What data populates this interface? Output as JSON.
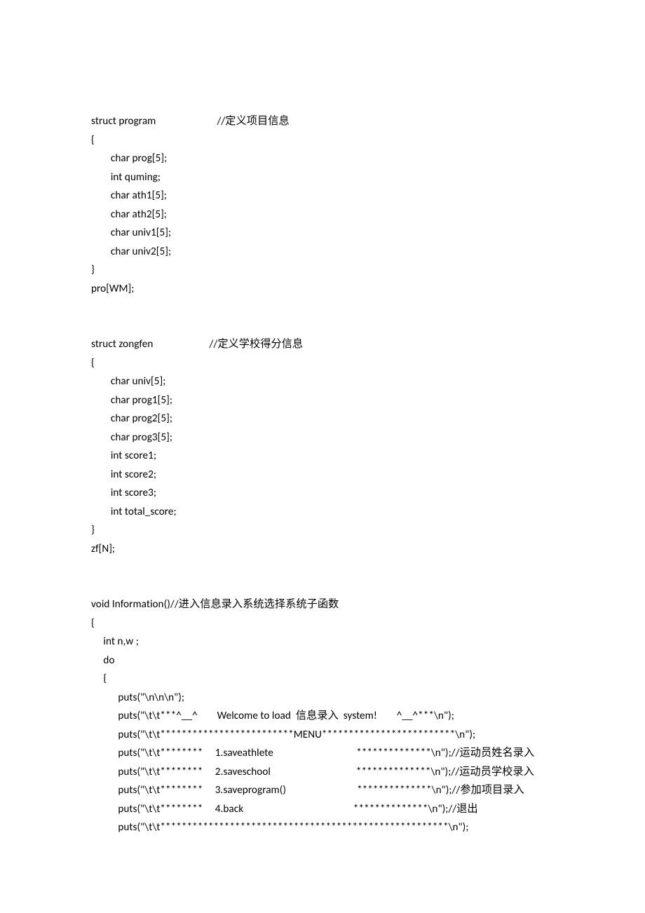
{
  "code": {
    "lines": [
      "struct program                         //定义项目信息",
      "{",
      "        char prog[5];",
      "        int quming;",
      "        char ath1[5];",
      "        char ath2[5];",
      "        char univ1[5];",
      "        char univ2[5];",
      "}",
      "pro[WM];",
      "",
      "",
      "struct zongfen                       //定义学校得分信息",
      "{",
      "        char univ[5];",
      "        char prog1[5];",
      "        char prog2[5];",
      "        char prog3[5];",
      "        int score1;",
      "        int score2;",
      "        int score3;",
      "        int total_score;",
      "}",
      "zf[N];",
      "",
      "",
      "void Information()//进入信息录入系统选择系统子函数",
      "{",
      "     int n,w ;",
      "     do",
      "     {",
      "           puts(\"\\n\\n\\n\");",
      "           puts(\"\\t\\t***^__^        Welcome to load  信息录入  system!        ^__^***\\n\");",
      "           puts(\"\\t\\t*************************MENU*************************\\n\");",
      "           puts(\"\\t\\t********     1.saveathlete                                  **************\\n\");//运动员姓名录入",
      "           puts(\"\\t\\t********     2.saveschool                                   **************\\n\");//运动员学校录入",
      "           puts(\"\\t\\t********     3.saveprogram()                             **************\\n\");//参加项目录入",
      "           puts(\"\\t\\t********     4.back                                             **************\\n\");//退出",
      "           puts(\"\\t\\t******************************************************\\n\");"
    ]
  }
}
